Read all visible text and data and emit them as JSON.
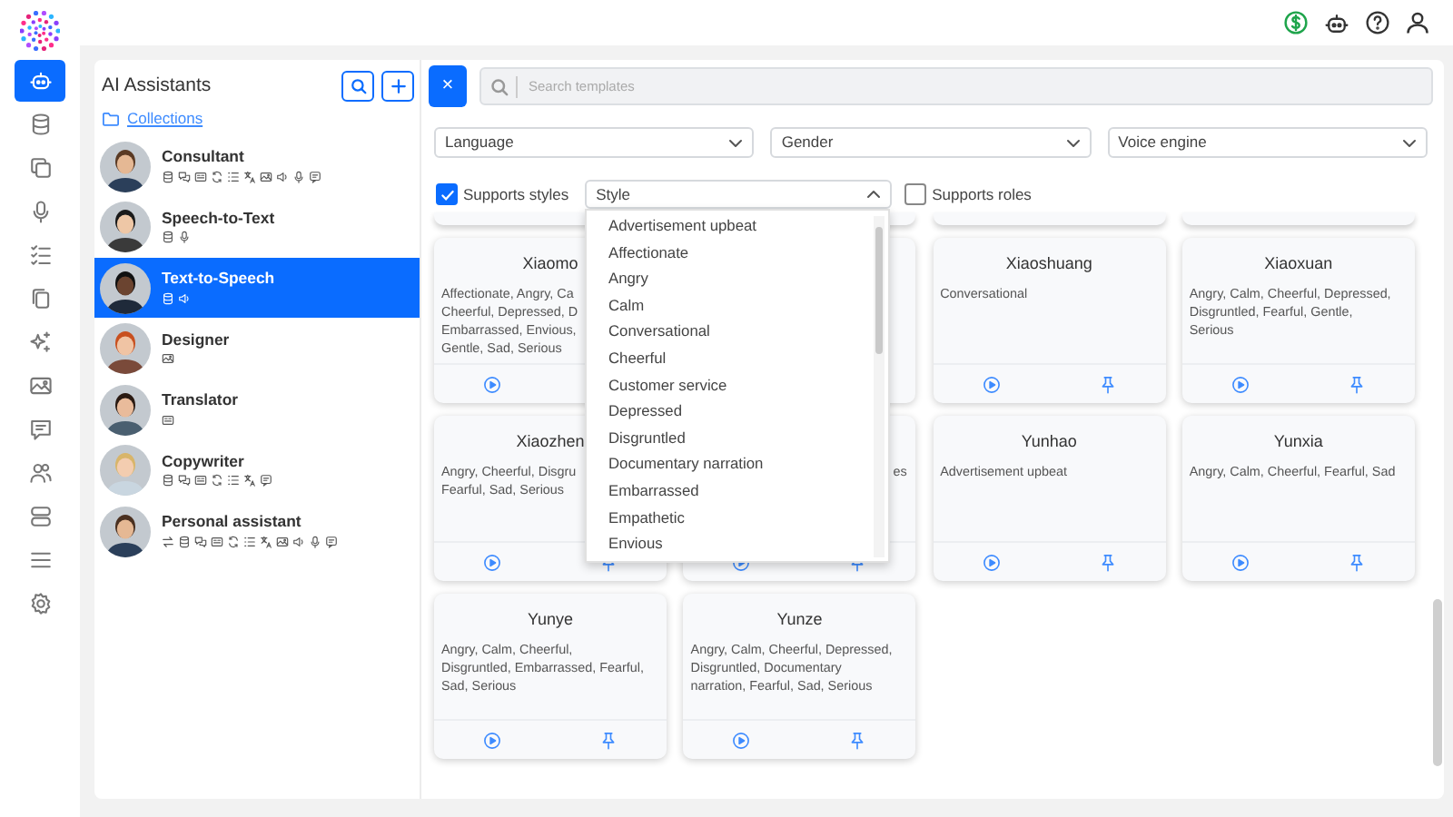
{
  "sidebar": {
    "items": [
      {
        "kind": "robot",
        "selected": true
      },
      {
        "kind": "database",
        "selected": false
      },
      {
        "kind": "copy",
        "selected": false
      },
      {
        "kind": "mic",
        "selected": false
      },
      {
        "kind": "checklist",
        "selected": false
      },
      {
        "kind": "files",
        "selected": false
      },
      {
        "kind": "sparkles",
        "selected": false
      },
      {
        "kind": "image",
        "selected": false
      },
      {
        "kind": "message",
        "selected": false
      },
      {
        "kind": "users",
        "selected": false
      },
      {
        "kind": "server",
        "selected": false
      },
      {
        "kind": "menu",
        "selected": false
      },
      {
        "kind": "gear",
        "selected": false
      }
    ]
  },
  "assistants_panel": {
    "title": "AI Assistants",
    "collections_link": "Collections",
    "items": [
      {
        "name": "Consultant",
        "selected": false,
        "tools": [
          {
            "kind": "database"
          },
          {
            "kind": "chat"
          },
          {
            "kind": "video"
          },
          {
            "kind": "sync"
          },
          {
            "kind": "list"
          },
          {
            "kind": "translate"
          },
          {
            "kind": "image"
          },
          {
            "kind": "speaker"
          },
          {
            "kind": "mic"
          },
          {
            "kind": "comment"
          }
        ]
      },
      {
        "name": "Speech-to-Text",
        "selected": false,
        "tools": [
          {
            "kind": "database"
          },
          {
            "kind": "mic"
          }
        ]
      },
      {
        "name": "Text-to-Speech",
        "selected": true,
        "tools": [
          {
            "kind": "database"
          },
          {
            "kind": "speaker"
          }
        ]
      },
      {
        "name": "Designer",
        "selected": false,
        "tools": [
          {
            "kind": "image"
          }
        ]
      },
      {
        "name": "Translator",
        "selected": false,
        "tools": [
          {
            "kind": "video"
          }
        ]
      },
      {
        "name": "Copywriter",
        "selected": false,
        "tools": [
          {
            "kind": "database"
          },
          {
            "kind": "chat"
          },
          {
            "kind": "video"
          },
          {
            "kind": "sync"
          },
          {
            "kind": "list"
          },
          {
            "kind": "translate"
          },
          {
            "kind": "comment"
          }
        ]
      },
      {
        "name": "Personal assistant",
        "selected": false,
        "tools": [
          {
            "kind": "swap"
          },
          {
            "kind": "database"
          },
          {
            "kind": "chat"
          },
          {
            "kind": "video"
          },
          {
            "kind": "sync"
          },
          {
            "kind": "list"
          },
          {
            "kind": "translate"
          },
          {
            "kind": "image"
          },
          {
            "kind": "speaker"
          },
          {
            "kind": "mic"
          },
          {
            "kind": "comment"
          }
        ]
      }
    ]
  },
  "close_button": {
    "label": "×"
  },
  "search": {
    "placeholder": "Search templates"
  },
  "filters": [
    {
      "value": "Language"
    },
    {
      "value": "Gender"
    },
    {
      "value": "Voice engine"
    }
  ],
  "supports_styles": {
    "label": "Supports styles",
    "checked": true
  },
  "style_select": {
    "value": "Style",
    "expanded": true,
    "options": [
      "Advertisement upbeat",
      "Affectionate",
      "Angry",
      "Calm",
      "Conversational",
      "Cheerful",
      "Customer service",
      "Depressed",
      "Disgruntled",
      "Documentary narration",
      "Embarrassed",
      "Empathetic",
      "Envious"
    ]
  },
  "supports_roles": {
    "label": "Supports roles",
    "checked": false
  },
  "cards": [
    {
      "kind": "voice",
      "title": "Xiaomo",
      "lines": [
        "Affectionate, Angry, Ca",
        "Cheerful, Depressed, D",
        "Embarrassed, Envious,",
        "Gentle, Sad, Serious"
      ],
      "footer": [
        {
          "kind": "play"
        }
      ]
    },
    {
      "kind": "covered"
    },
    {
      "kind": "voice",
      "title": "Xiaoshuang",
      "lines": [
        "Conversational"
      ],
      "footer": [
        {
          "kind": "play"
        },
        {
          "kind": "pin"
        }
      ]
    },
    {
      "kind": "voice",
      "title": "Xiaoxuan",
      "lines": [
        "Angry, Calm, Cheerful, Depressed,",
        "Disgruntled, Fearful, Gentle,",
        "Serious"
      ],
      "footer": [
        {
          "kind": "play"
        },
        {
          "kind": "pin"
        }
      ]
    },
    {
      "kind": "voice",
      "title": "Xiaozhen",
      "lines": [
        "Angry, Cheerful, Disgru",
        "Fearful, Sad, Serious"
      ],
      "footer": [
        {
          "kind": "play"
        },
        {
          "kind": "pin"
        }
      ]
    },
    {
      "kind": "covered",
      "lines": [
        "es"
      ],
      "footer": [
        {
          "kind": "play"
        },
        {
          "kind": "pin"
        }
      ]
    },
    {
      "kind": "voice",
      "title": "Yunhao",
      "lines": [
        "Advertisement upbeat"
      ],
      "footer": [
        {
          "kind": "play"
        },
        {
          "kind": "pin"
        }
      ]
    },
    {
      "kind": "voice",
      "title": "Yunxia",
      "lines": [
        "Angry, Calm, Cheerful, Fearful, Sad"
      ],
      "footer": [
        {
          "kind": "play"
        },
        {
          "kind": "pin"
        }
      ]
    },
    {
      "kind": "voice",
      "title": "Yunye",
      "lines": [
        "Angry, Calm, Cheerful,",
        "Disgruntled, Embarrassed, Fearful,",
        "Sad, Serious"
      ],
      "footer": [
        {
          "kind": "play"
        },
        {
          "kind": "pin"
        }
      ]
    },
    {
      "kind": "voice",
      "title": "Yunze",
      "lines": [
        "Angry, Calm, Cheerful, Depressed,",
        "Disgruntled, Documentary",
        "narration, Fearful, Sad, Serious"
      ],
      "footer": [
        {
          "kind": "play"
        },
        {
          "kind": "pin"
        }
      ]
    }
  ]
}
